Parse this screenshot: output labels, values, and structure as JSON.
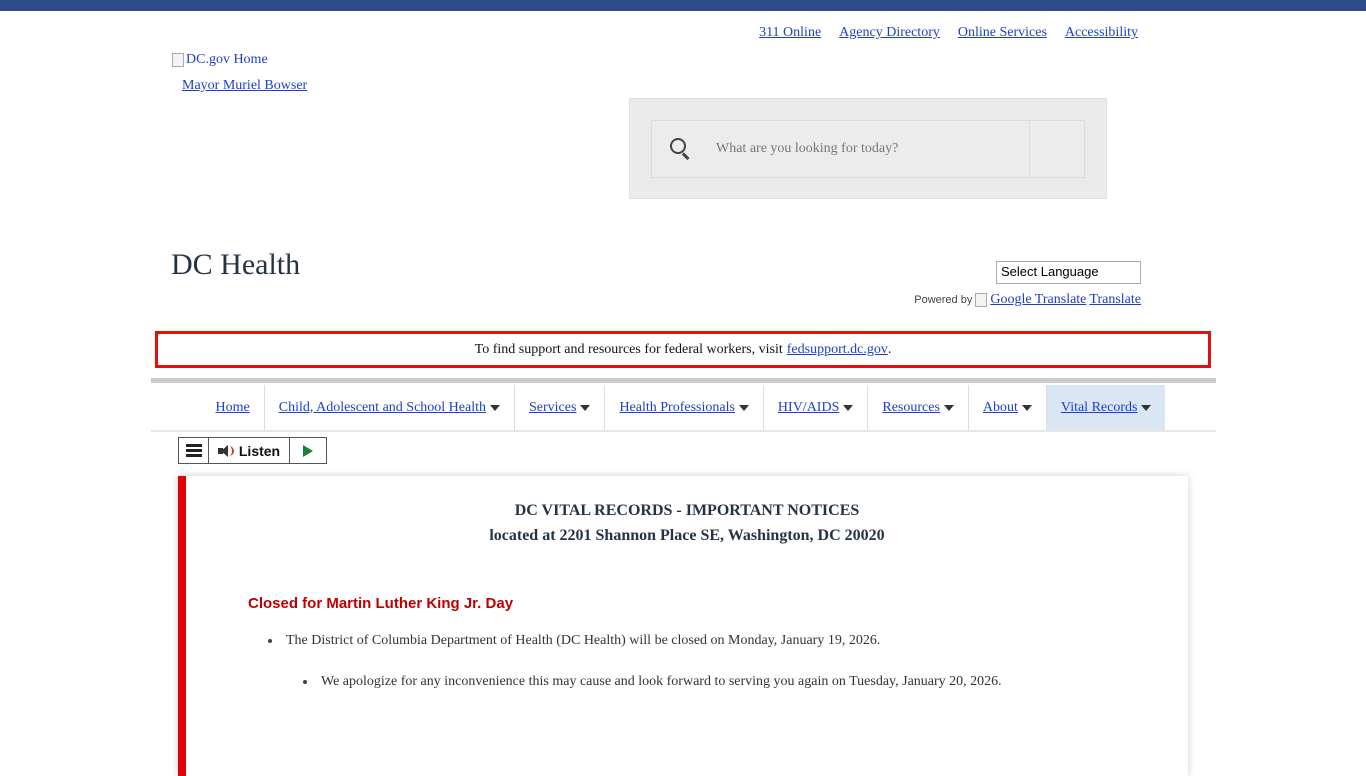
{
  "utility_links": [
    "311 Online",
    "Agency Directory",
    "Online Services",
    "Accessibility"
  ],
  "logo": {
    "alt": "DC.gov Home"
  },
  "mayor_link": "Mayor Muriel Bowser",
  "search": {
    "placeholder": "What are you looking for today?"
  },
  "site_title": "DC Health",
  "language": {
    "selected": "Select Language",
    "powered_by": "Powered by",
    "google_alt": "Google Translate",
    "translate_link": "Translate"
  },
  "alert": {
    "text": "To find support and resources for federal workers, visit",
    "link": "fedsupport.dc.gov",
    "suffix": "."
  },
  "nav": {
    "items": [
      {
        "label": "Home",
        "dropdown": false
      },
      {
        "label": "Child, Adolescent and School Health",
        "dropdown": true
      },
      {
        "label": "Services",
        "dropdown": true
      },
      {
        "label": "Health Professionals",
        "dropdown": true
      },
      {
        "label": "HIV/AIDS",
        "dropdown": true
      },
      {
        "label": "Resources",
        "dropdown": true
      },
      {
        "label": "About",
        "dropdown": true
      },
      {
        "label": "Vital Records",
        "dropdown": true,
        "active": true
      }
    ]
  },
  "listen": {
    "label": "Listen"
  },
  "content": {
    "title_line1": "DC VITAL RECORDS - IMPORTANT NOTICES",
    "title_line2": "located at 2201 Shannon Place SE, Washington, DC 20020",
    "closed_heading": "Closed for Martin Luther King Jr. Day",
    "bullet1": "The District of Columbia Department of Health (DC Health) will be closed on Monday, January 19, 2026.",
    "bullet2": "We apologize for any inconvenience this may cause and look forward to serving you again on Tuesday, January 20, 2026."
  },
  "colors": {
    "topbar": "#2e4a8a",
    "alert_border": "#e01010",
    "heading_red": "#c00000",
    "nav_active_bg": "#dbe6f5"
  }
}
